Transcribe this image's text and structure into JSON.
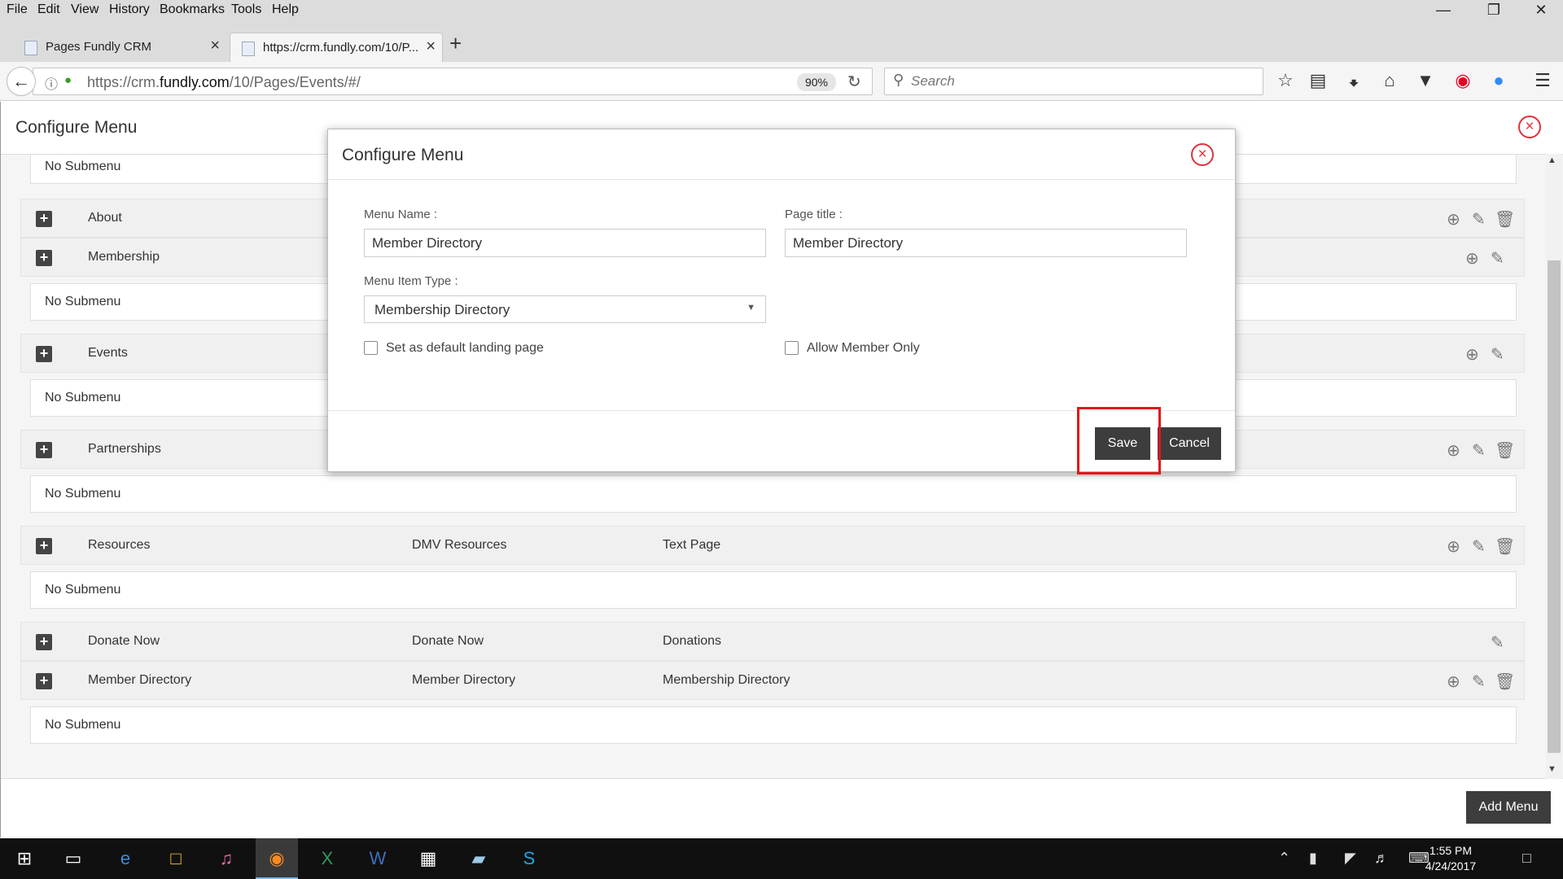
{
  "browser": {
    "menu": [
      "File",
      "Edit",
      "View",
      "History",
      "Bookmarks",
      "Tools",
      "Help"
    ],
    "tabs": [
      {
        "label": "Pages Fundly CRM"
      },
      {
        "label": "https://crm.fundly.com/10/P..."
      }
    ],
    "url_prefix": "https://crm.",
    "url_domain": "fundly.com",
    "url_path": "/10/Pages/Events/#/",
    "zoom": "90%",
    "search_placeholder": "Search"
  },
  "page": {
    "title": "Configure Menu",
    "add_menu_label": "Add Menu",
    "no_submenu": "No Submenu",
    "rows": [
      {
        "name": "About",
        "page_title": "",
        "type": ""
      },
      {
        "name": "Membership",
        "page_title": "",
        "type": ""
      },
      {
        "name": "Events",
        "page_title": "",
        "type": ""
      },
      {
        "name": "Partnerships",
        "page_title": "",
        "type": ""
      },
      {
        "name": "Resources",
        "page_title": "DMV Resources",
        "type": "Text Page"
      },
      {
        "name": "Donate Now",
        "page_title": "Donate Now",
        "type": "Donations"
      },
      {
        "name": "Member Directory",
        "page_title": "Member Directory",
        "type": "Membership Directory"
      }
    ]
  },
  "modal": {
    "title": "Configure Menu",
    "menu_name_label": "Menu Name :",
    "menu_name_value": "Member Directory",
    "page_title_label": "Page title :",
    "page_title_value": "Member Directory",
    "menu_item_type_label": "Menu Item Type :",
    "menu_item_type_value": "Membership Directory",
    "default_landing_label": "Set as default landing page",
    "allow_member_label": "Allow Member Only",
    "save_label": "Save",
    "cancel_label": "Cancel"
  },
  "taskbar": {
    "time": "1:55 PM",
    "date": "4/24/2017"
  },
  "colors": {
    "accent_red": "#e0323c",
    "button_dark": "#3d3d3d",
    "highlight": "#e0141e"
  }
}
